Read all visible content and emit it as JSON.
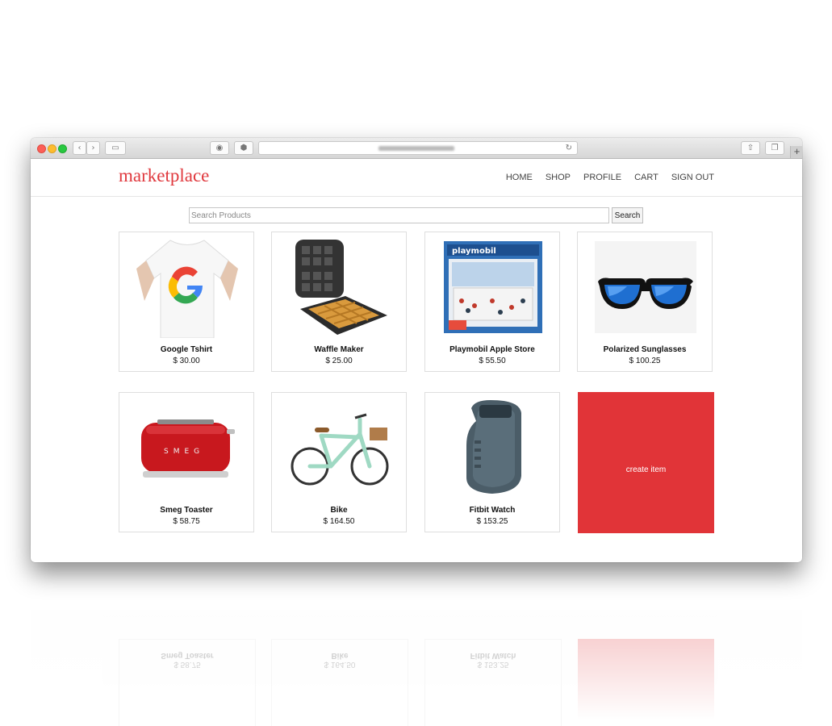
{
  "brand": {
    "name": "marketplace",
    "color": "#e0393e"
  },
  "nav": [
    {
      "label": "HOME"
    },
    {
      "label": "SHOP"
    },
    {
      "label": "PROFILE"
    },
    {
      "label": "CART"
    },
    {
      "label": "SIGN OUT"
    }
  ],
  "search": {
    "placeholder": "Search Products",
    "button_label": "Search"
  },
  "browser": {
    "icons": [
      "back-icon",
      "forward-icon",
      "sidebar-icon",
      "grammarly-icon",
      "adblock-icon",
      "reload-icon",
      "share-icon",
      "tabs-icon",
      "new-tab-icon"
    ]
  },
  "products": [
    {
      "name": "Google Tshirt",
      "price": "$ 30.00",
      "icon": "tshirt-image"
    },
    {
      "name": "Waffle Maker",
      "price": "$ 25.00",
      "icon": "waffle-maker-image"
    },
    {
      "name": "Playmobil Apple Store",
      "price": "$ 55.50",
      "icon": "playmobil-box-image"
    },
    {
      "name": "Polarized Sunglasses",
      "price": "$ 100.25",
      "icon": "sunglasses-image"
    },
    {
      "name": "Smeg Toaster",
      "price": "$ 58.75",
      "icon": "toaster-image"
    },
    {
      "name": "Bike",
      "price": "$ 164.50",
      "icon": "bike-image"
    },
    {
      "name": "Fitbit Watch",
      "price": "$ 153.25",
      "icon": "fitbit-image"
    }
  ],
  "create_item": {
    "label": "create item",
    "color": "#e13438"
  },
  "reflection": {
    "labels": [
      "Smeg Toaster",
      "Bike",
      "Fitbit Watch"
    ],
    "prices": [
      "$ 58.75",
      "$ 164.50",
      "$ 153.25"
    ]
  }
}
